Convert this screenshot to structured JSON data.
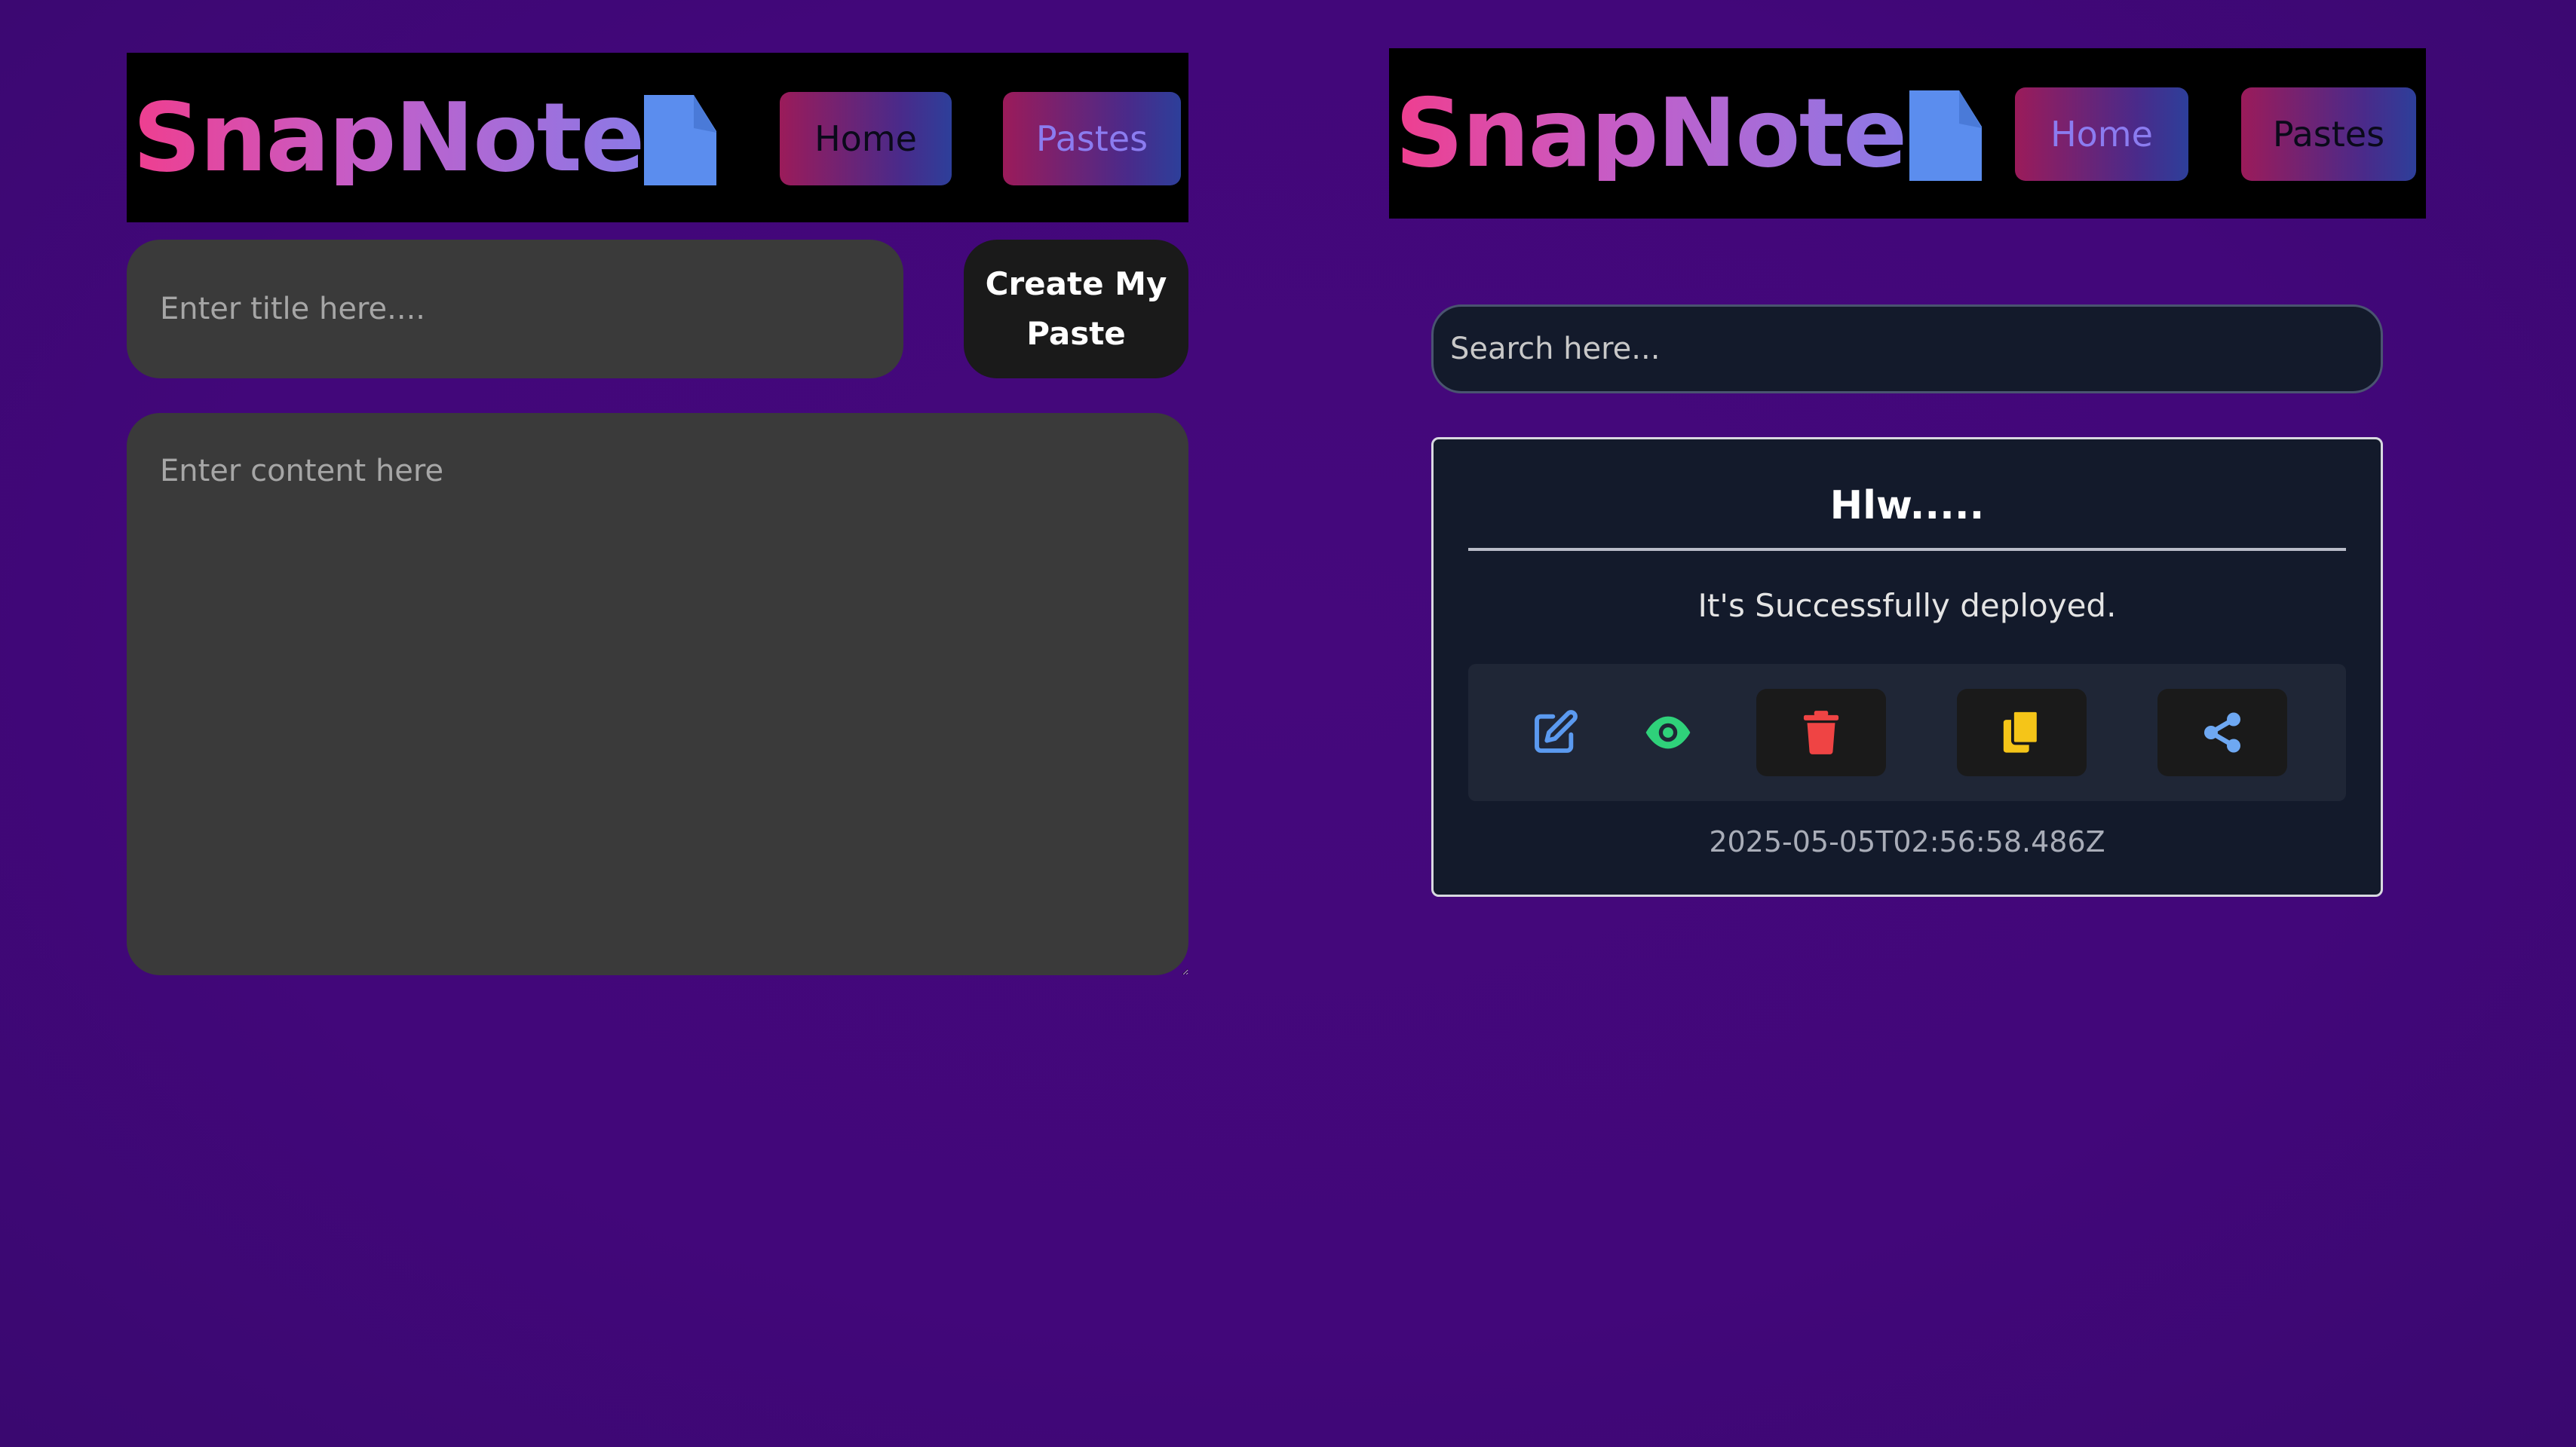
{
  "app": {
    "brand": "SnapNote",
    "brand_gradient": [
      "#ef3e8f",
      "#c45ec9",
      "#8b79e6"
    ],
    "accent_blue": "#5b8dee",
    "icon_name": "document-icon"
  },
  "left_panel": {
    "nav": {
      "home_label": "Home",
      "pastes_label": "Pastes"
    },
    "form": {
      "title_placeholder": "Enter title here....",
      "title_value": "",
      "create_button_label": "Create My Paste",
      "content_placeholder": "Enter content here",
      "content_value": ""
    }
  },
  "right_panel": {
    "nav": {
      "home_label": "Home",
      "pastes_label": "Pastes"
    },
    "search": {
      "placeholder": "Search here...",
      "value": ""
    },
    "pastes": [
      {
        "title": "Hlw.....",
        "content": "It's Successfully deployed.",
        "created_at": "2025-05-05T02:56:58.486Z",
        "actions": [
          {
            "name": "edit",
            "icon": "edit-icon",
            "color": "#5b9af0"
          },
          {
            "name": "view",
            "icon": "eye-icon",
            "color": "#2fd17a"
          },
          {
            "name": "delete",
            "icon": "trash-icon",
            "color": "#ef4444"
          },
          {
            "name": "copy",
            "icon": "copy-icon",
            "color": "#f5c518"
          },
          {
            "name": "share",
            "icon": "share-icon",
            "color": "#6ea8f2"
          }
        ]
      }
    ]
  }
}
